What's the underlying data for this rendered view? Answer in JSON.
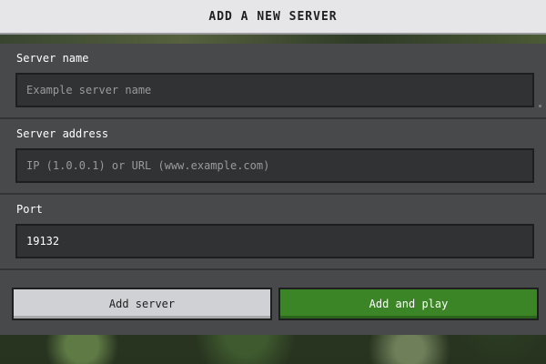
{
  "header": {
    "title": "ADD A NEW SERVER"
  },
  "form": {
    "server_name": {
      "label": "Server name",
      "placeholder": "Example server name",
      "value": ""
    },
    "server_address": {
      "label": "Server address",
      "placeholder": "IP (1.0.0.1) or URL (www.example.com)",
      "value": ""
    },
    "port": {
      "label": "Port",
      "placeholder": "",
      "value": "19132"
    }
  },
  "actions": {
    "add_server_label": "Add server",
    "add_and_play_label": "Add and play"
  },
  "colors": {
    "accent_green": "#3c8527",
    "panel": "#48494a",
    "field": "#313233"
  }
}
